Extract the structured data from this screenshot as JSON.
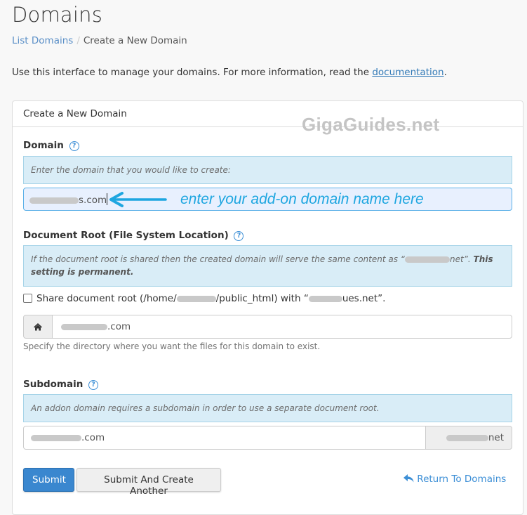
{
  "page": {
    "title": "Domains",
    "breadcrumb": {
      "link": "List Domains",
      "separator": "/",
      "current": "Create a New Domain"
    },
    "intro_text": "Use this interface to manage your domains. For more information, read the ",
    "intro_link": "documentation",
    "intro_end": "."
  },
  "panel": {
    "heading": "Create a New Domain",
    "watermark": "GigaGuides.net"
  },
  "domain": {
    "label": "Domain",
    "help_icon": "question-circle-icon",
    "hint": "Enter the domain that you would like to create:",
    "value_suffix": "s.com",
    "annotation": "enter your add-on domain name here",
    "annotation_color": "#1ea6e0"
  },
  "docroot": {
    "label": "Document Root (File System Location)",
    "help_icon": "question-circle-icon",
    "hint_start": "If the document root is shared then the created domain will serve the same content as “",
    "hint_mid": "net”. ",
    "hint_bold": "This setting is permanent.",
    "checkbox_label_start": "Share document root (/home/",
    "checkbox_label_mid": "/public_html) with “",
    "checkbox_label_end": "ues.net”.",
    "checkbox_checked": false,
    "home_icon": "home-icon",
    "value_suffix": ".com",
    "help_text": "Specify the directory where you want the files for this domain to exist."
  },
  "subdomain": {
    "label": "Subdomain",
    "help_icon": "question-circle-icon",
    "hint": "An addon domain requires a subdomain in order to use a separate document root.",
    "value_suffix": ".com",
    "addon_suffix": "net"
  },
  "actions": {
    "submit": "Submit",
    "submit_another": "Submit And Create Another",
    "return_link": "Return To Domains",
    "return_icon": "reply-icon"
  },
  "colors": {
    "primary": "#3a87cf",
    "link": "#3d8fd6",
    "alert_bg": "#d9edf7"
  }
}
